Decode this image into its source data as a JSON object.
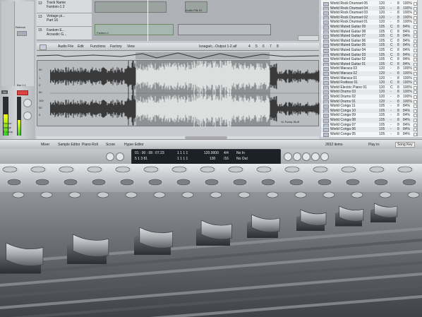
{
  "tracks": [
    {
      "number": "13",
      "name": "Vintage pi..."
    },
    {
      "number": "14",
      "name": "Part 16"
    },
    {
      "number": "15",
      "name": "Fantom E... Acoustic G..."
    }
  ],
  "track_name_label": "Track Name",
  "track_sub": "Fantom-1 2",
  "regions": [
    "Fantom-1",
    "Audio File 01"
  ],
  "left_panel": {
    "refresh": "Refresh",
    "on": "On",
    "off": "Off",
    "anchor": "Anchor",
    "nudge": "Nudge",
    "s_loop": "S. Loop",
    "bar1": "Bar",
    "bar2": "Bar 1.1"
  },
  "editor_menu": [
    "Audio File",
    "Edit",
    "Functions",
    "Factory",
    "View"
  ],
  "overview_label": "Isoaga/c...Output 1-2.aif",
  "overview_nums": [
    "4",
    "5",
    "6",
    "7",
    "8"
  ],
  "ruler": [
    "50",
    "1",
    "0",
    "50",
    "100",
    "50",
    "0",
    "50",
    "100"
  ],
  "wave_caption": "Yo Funky Stuff",
  "wave_left_labels": [
    "Anchor",
    "Nudge",
    "S. Loop"
  ],
  "bottom_tabs": [
    "Mixer",
    "Sample Editor",
    "Piano Roll",
    "Score",
    "Hyper Editor"
  ],
  "transport": {
    "time_top": "01 : 00 : 08 : 07.23",
    "time_bottom": "5  1  3  81",
    "pos_top": "1  1  1  1",
    "pos_bottom": "1  1  1  1",
    "tempo": "120.0000",
    "tempo_sub": "130",
    "sig": "4/4",
    "sig_sub": "/16",
    "in_label": "No In",
    "out_label": "No Out"
  },
  "list_rows": [
    [
      "World Rock Drumset 05",
      "120",
      "-",
      "8",
      "100%"
    ],
    [
      "World Rock Drumset 04",
      "120",
      "-",
      "8",
      "100%"
    ],
    [
      "World Rock Drumset 03",
      "120",
      "-",
      "8",
      "100%"
    ],
    [
      "World Rock Drumset 02",
      "120",
      "-",
      "8",
      "100%"
    ],
    [
      "World Rock Drumset 01",
      "120",
      "-",
      "8",
      "100%"
    ],
    [
      "World Muted Guitar 09",
      "105",
      "C",
      "8",
      "84%"
    ],
    [
      "World Muted Guitar 08",
      "105",
      "C",
      "8",
      "84%"
    ],
    [
      "World Muted Guitar 07",
      "105",
      "C",
      "8",
      "84%"
    ],
    [
      "World Muted Guitar 06",
      "105",
      "C",
      "8",
      "84%"
    ],
    [
      "World Muted Guitar 05",
      "105",
      "C",
      "8",
      "84%"
    ],
    [
      "World Muted Guitar 04",
      "105",
      "C",
      "8",
      "84%"
    ],
    [
      "World Muted Guitar 03",
      "105",
      "C",
      "8",
      "84%"
    ],
    [
      "World Muted Guitar 02",
      "105",
      "C",
      "8",
      "84%"
    ],
    [
      "World Muted Guitar 01",
      "105",
      "C",
      "8",
      "84%"
    ],
    [
      "World Maraca 03",
      "120",
      "-",
      "8",
      "100%"
    ],
    [
      "World Maraca 02",
      "120",
      "-",
      "8",
      "100%"
    ],
    [
      "World Maraca 01",
      "120",
      "-",
      "8",
      "100%"
    ],
    [
      "World Fretless 01",
      "120",
      "C",
      "8",
      "100%"
    ],
    [
      "World Electric Piano 01",
      "120",
      "C",
      "8",
      "100%"
    ],
    [
      "World Drums 03",
      "120",
      "-",
      "8",
      "100%"
    ],
    [
      "World Drums 02",
      "120",
      "-",
      "8",
      "100%"
    ],
    [
      "World Drums 01",
      "120",
      "-",
      "8",
      "100%"
    ],
    [
      "World Conga 11",
      "105",
      "-",
      "8",
      "84%"
    ],
    [
      "World Conga 10",
      "105",
      "-",
      "8",
      "84%"
    ],
    [
      "World Conga 09",
      "105",
      "-",
      "8",
      "84%"
    ],
    [
      "World Conga 08",
      "105",
      "-",
      "8",
      "84%"
    ],
    [
      "World Conga 07",
      "105",
      "-",
      "8",
      "84%"
    ],
    [
      "World Conga 06",
      "105",
      "-",
      "8",
      "84%"
    ],
    [
      "World Conga 05",
      "105",
      "-",
      "8",
      "84%"
    ]
  ],
  "list_footer": {
    "count": "2832 items",
    "play_in": "Play in:",
    "key": "Song Key"
  },
  "colors": {
    "screen_bg": "#c8cbcf",
    "lcd_bg": "#1b2127",
    "lcd_text": "#e9eef2",
    "console_body": "#4c5056",
    "fader_cap": "#c6c9cc"
  }
}
